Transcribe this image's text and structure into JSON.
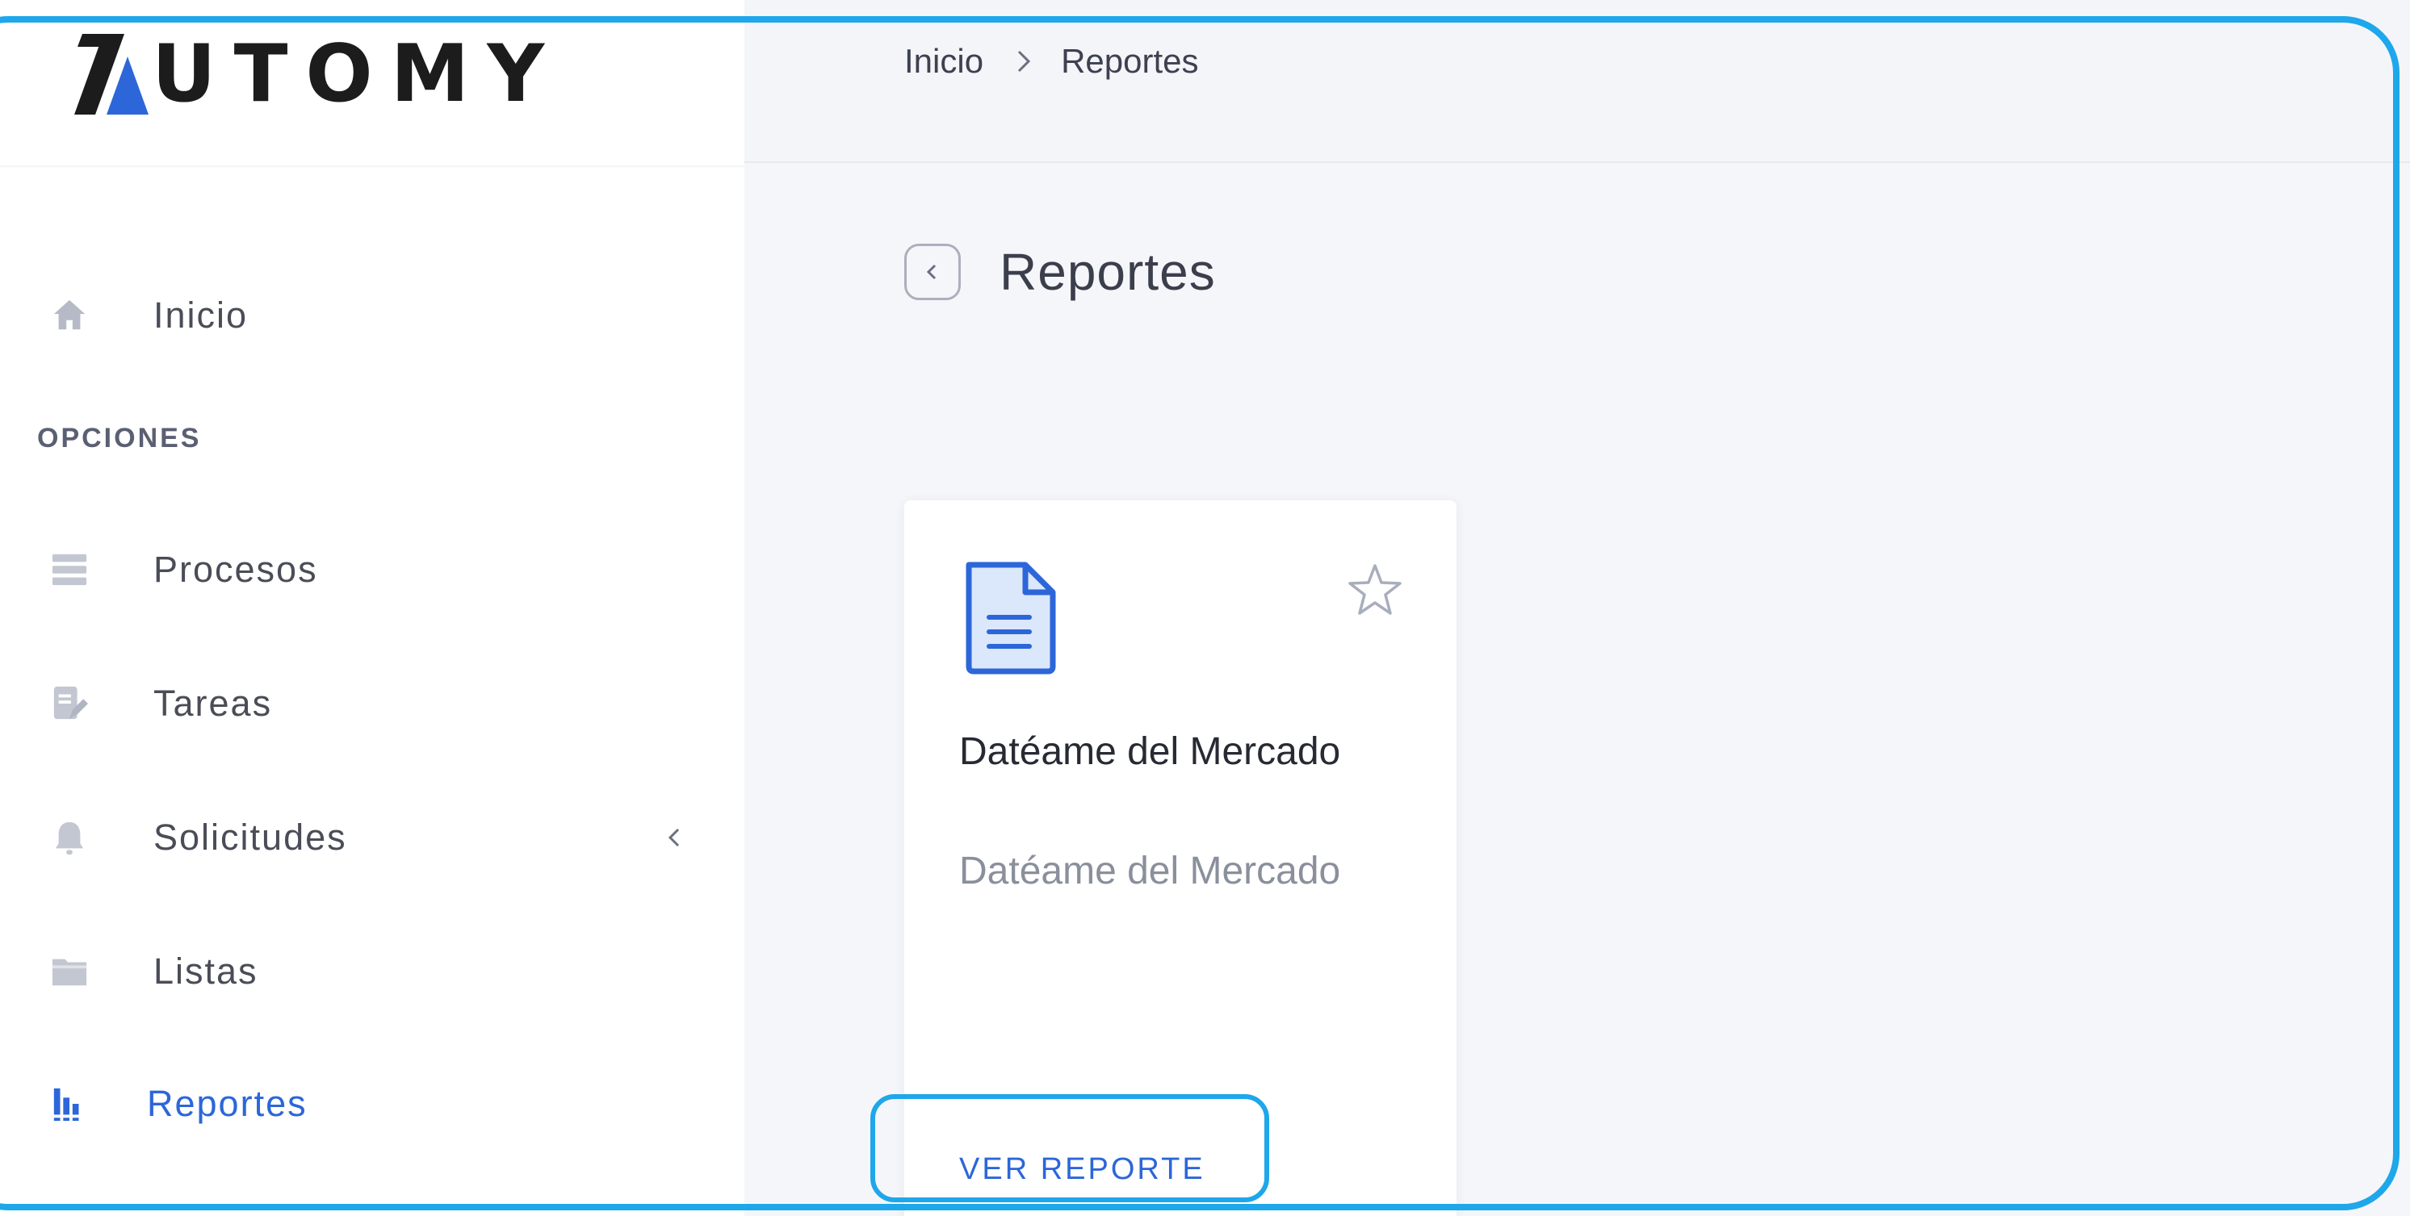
{
  "brand": {
    "name": "UTOMY",
    "accent_color": "#2c66d9",
    "highlight_color": "#1ea7ea"
  },
  "breadcrumb": {
    "items": [
      "Inicio",
      "Reportes"
    ]
  },
  "sidebar": {
    "items": [
      {
        "label": "Inicio",
        "icon": "home-icon"
      },
      {
        "label": "Procesos",
        "icon": "server-icon"
      },
      {
        "label": "Tareas",
        "icon": "edit-note-icon"
      },
      {
        "label": "Solicitudes",
        "icon": "bell-icon"
      },
      {
        "label": "Listas",
        "icon": "folder-icon"
      },
      {
        "label": "Reportes",
        "icon": "bar-chart-icon",
        "active": true
      }
    ],
    "section_label": "OPCIONES"
  },
  "page": {
    "title": "Reportes"
  },
  "reports": [
    {
      "title": "Datéame del Mercado",
      "description": "Datéame del Mercado",
      "action_label": "VER REPORTE"
    }
  ]
}
